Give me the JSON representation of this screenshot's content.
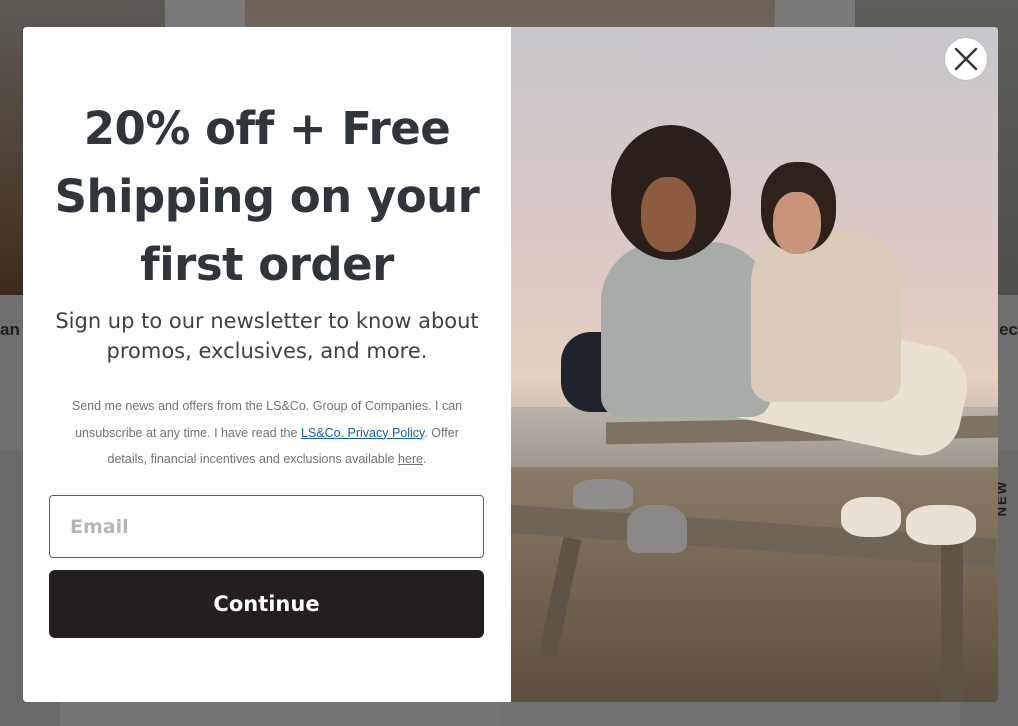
{
  "background": {
    "left_snippet": "an",
    "right_snippet": "ec",
    "side_label": "NEW"
  },
  "modal": {
    "headline": "20% off + Free Shipping on your first order",
    "subhead": "Sign up to our newsletter to know about promos, exclusives, and more.",
    "legal": {
      "part1": "Send me news and offers from the LS&Co. Group of Companies. I can unsubscribe at any time. I have read the ",
      "privacy_link": "LS&Co. Privacy Policy",
      "part2": ". Offer details, financial incentives and exclusions available ",
      "here_link": "here",
      "part3": "."
    },
    "email": {
      "placeholder": "Email",
      "value": ""
    },
    "continue_label": "Continue",
    "close_icon": "close-icon"
  },
  "colors": {
    "button_bg": "#231f20",
    "headline": "#2f353b",
    "link": "#1a5ea8"
  }
}
